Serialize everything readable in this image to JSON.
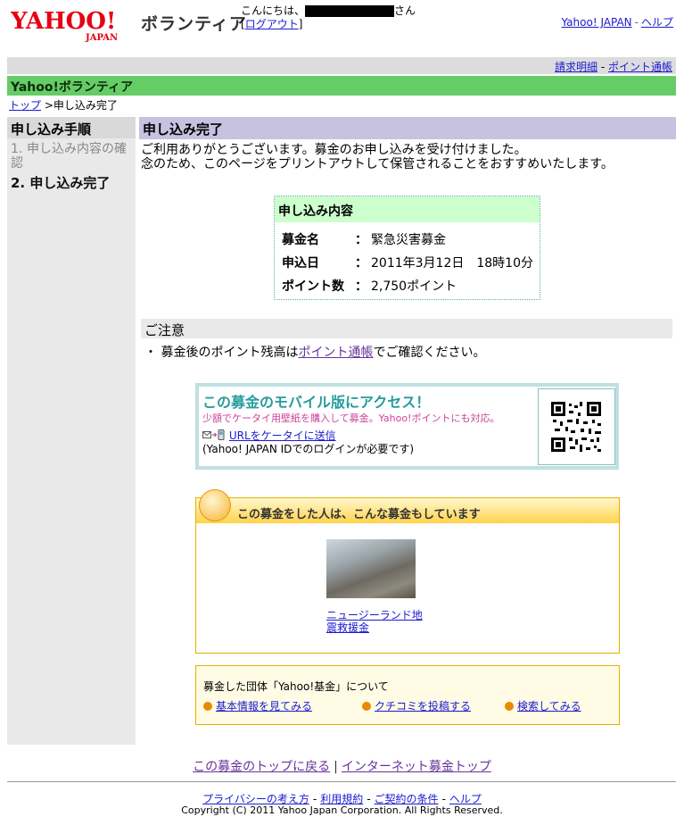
{
  "header": {
    "logo": {
      "main": "YAHOO!",
      "sub": "JAPAN"
    },
    "brand": "ボランティア",
    "greeting_prefix": "こんにちは、",
    "greeting_suffix": "さん",
    "logout_open": "[",
    "logout": "ログアウト",
    "logout_close": "]",
    "links": [
      "Yahoo! JAPAN",
      "ヘルプ"
    ]
  },
  "subnav": {
    "links": [
      "請求明細",
      "ポイント通帳"
    ]
  },
  "section_title": "Yahoo!ボランティア",
  "breadcrumb": {
    "top": "トップ",
    "sep": " >",
    "current": "申し込み完了"
  },
  "steps": {
    "title": "申し込み手順",
    "items": [
      {
        "num": "1.",
        "label": "申し込み内容の確認"
      },
      {
        "num": "2.",
        "label": "申し込み完了"
      }
    ]
  },
  "main": {
    "title": "申し込み完了",
    "thanks_1": "ご利用ありがとうございます。募金のお申し込みを受け付けました。",
    "thanks_2": "念のため、このページをプリントアウトして保管されることをおすすめいたします。"
  },
  "summary": {
    "title": "申し込み内容",
    "rows": [
      {
        "key": "募金名",
        "colon": "：",
        "value": "緊急災害募金"
      },
      {
        "key": "申込日",
        "colon": "：",
        "value": "2011年3月12日　18時10分"
      },
      {
        "key": "ポイント数",
        "colon": "：",
        "value": "2,750ポイント"
      }
    ]
  },
  "notice": {
    "title": "ご注意",
    "bullet": "・",
    "before": "募金後のポイント残高は",
    "link": "ポイント通帳",
    "after": "でご確認ください。"
  },
  "mobile": {
    "title": "この募金のモバイル版にアクセス！",
    "subtitle": "少額でケータイ用壁紙を購入して募金。Yahoo!ポイントにも対応。",
    "send_link": "URLをケータイに送信",
    "login_note": "(Yahoo! JAPAN IDでのログインが必要です)"
  },
  "related": {
    "title": "この募金をした人は、こんな募金もしています",
    "item_caption": "ニュージーランド地震救援金"
  },
  "org": {
    "title": "募金した団体「Yahoo!基金」について",
    "links": [
      "基本情報を見てみる",
      "クチコミを投稿する",
      "検索してみる"
    ]
  },
  "bottom_links": [
    "この募金のトップに戻る",
    "インターネット募金トップ"
  ],
  "bottom_sep": "|",
  "footer": {
    "links": [
      "プライバシーの考え方",
      "利用規約",
      "ご契約の条件",
      "ヘルプ"
    ],
    "sep": "-",
    "copyright": "Copyright (C) 2011 Yahoo Japan Corporation. All Rights Reserved."
  },
  "colors": {
    "green_bar": "#66cc66",
    "title_bar": "#c6c2e0",
    "accent_teal": "#279c9c",
    "accent_orange": "#e98a00"
  }
}
